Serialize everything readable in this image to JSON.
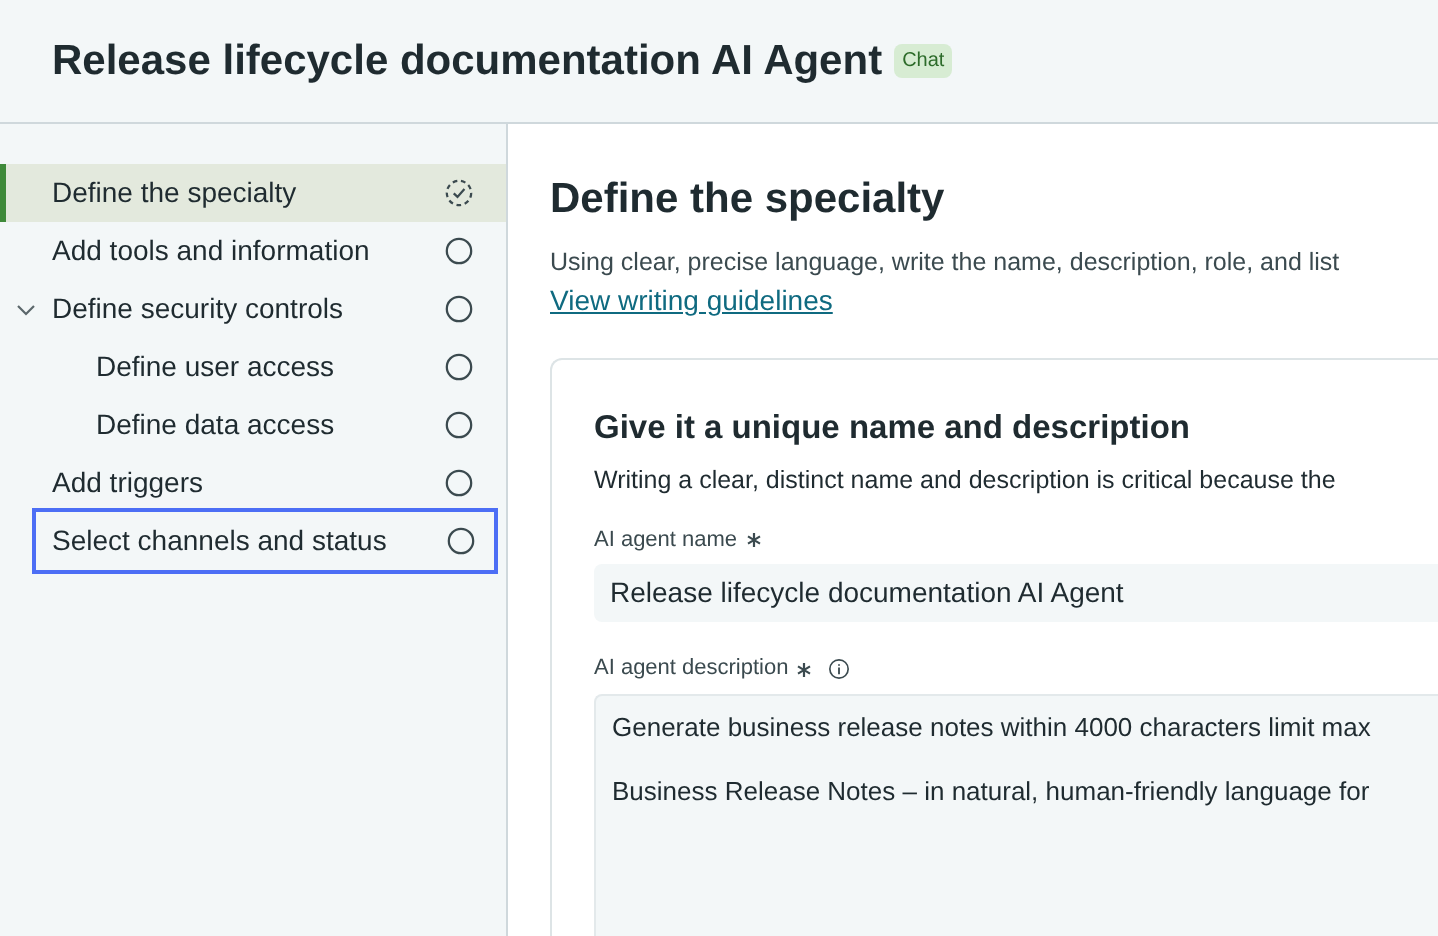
{
  "header": {
    "title": "Release lifecycle documentation AI Agent",
    "badge": "Chat"
  },
  "sidebar": {
    "items": [
      {
        "label": "Define the specialty",
        "in_progress": true,
        "selected": true,
        "focused": false
      },
      {
        "label": "Add tools and information",
        "in_progress": false,
        "selected": false,
        "focused": false
      },
      {
        "label": "Define security controls",
        "in_progress": false,
        "selected": false,
        "focused": false,
        "expanded": true,
        "children": [
          {
            "label": "Define user access",
            "in_progress": false,
            "selected": false,
            "focused": false
          },
          {
            "label": "Define data access",
            "in_progress": false,
            "selected": false,
            "focused": false
          }
        ]
      },
      {
        "label": "Add triggers",
        "in_progress": false,
        "selected": false,
        "focused": false
      },
      {
        "label": "Select channels and status",
        "in_progress": false,
        "selected": false,
        "focused": true
      }
    ]
  },
  "main": {
    "title": "Define the specialty",
    "intro": "Using clear, precise language, write the name, description, role, and list",
    "link": "View writing guidelines",
    "card": {
      "title": "Give it a unique name and description",
      "subtitle": "Writing a clear, distinct name and description is critical because the",
      "name_field": {
        "label": "AI agent name",
        "required": true,
        "value": "Release lifecycle documentation AI Agent"
      },
      "description_field": {
        "label": "AI agent description",
        "required": true,
        "value_lines": [
          "Generate business release notes within 4000 characters limit max",
          "Business Release Notes – in natural, human-friendly language for"
        ]
      }
    }
  }
}
